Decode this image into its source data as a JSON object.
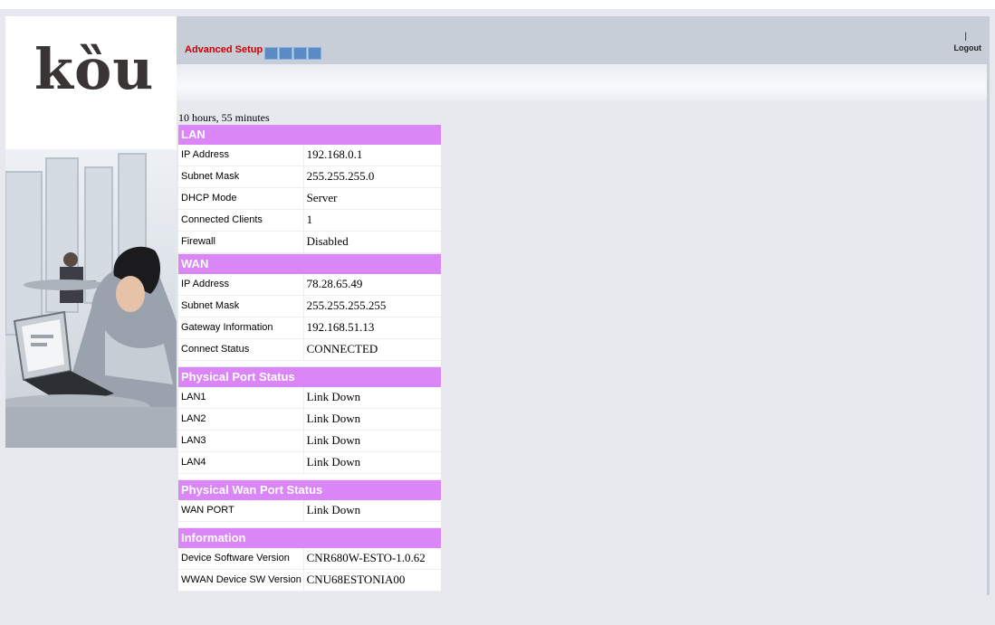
{
  "logo": {
    "text": "kȍu"
  },
  "header": {
    "advanced_setup": "Advanced Setup",
    "pipe": "|",
    "logout": "Logout"
  },
  "uptime": "10 hours, 55 minutes",
  "sections": {
    "lan": {
      "title": "LAN",
      "rows": [
        {
          "label": "IP Address",
          "value": "192.168.0.1"
        },
        {
          "label": "Subnet Mask",
          "value": "255.255.255.0"
        },
        {
          "label": "DHCP Mode",
          "value": "Server"
        },
        {
          "label": "Connected Clients",
          "value": "1"
        },
        {
          "label": "Firewall",
          "value": "Disabled"
        }
      ]
    },
    "wan": {
      "title": "WAN",
      "rows": [
        {
          "label": "IP Address",
          "value": "78.28.65.49"
        },
        {
          "label": "Subnet Mask",
          "value": "255.255.255.255"
        },
        {
          "label": "Gateway Information",
          "value": "192.168.51.13"
        },
        {
          "label": "Connect Status",
          "value": "CONNECTED"
        }
      ]
    },
    "physical_port": {
      "title": "Physical Port Status",
      "rows": [
        {
          "label": "LAN1",
          "value": "Link Down"
        },
        {
          "label": "LAN2",
          "value": "Link Down"
        },
        {
          "label": "LAN3",
          "value": "Link Down"
        },
        {
          "label": "LAN4",
          "value": "Link Down"
        }
      ]
    },
    "physical_wan": {
      "title": "Physical Wan Port Status",
      "rows": [
        {
          "label": "WAN PORT",
          "value": "Link Down"
        }
      ]
    },
    "information": {
      "title": "Information",
      "rows": [
        {
          "label": "Device Software Version",
          "value": "CNR680W-ESTO-1.0.62"
        },
        {
          "label": "WWAN Device SW Version",
          "value": "CNU68ESTONIA00"
        }
      ]
    }
  },
  "colors": {
    "section_header": "#da86f7",
    "header_bar": "#c7ced8",
    "nav_square": "#5b8bc4",
    "advanced_setup": "#cc0000"
  }
}
